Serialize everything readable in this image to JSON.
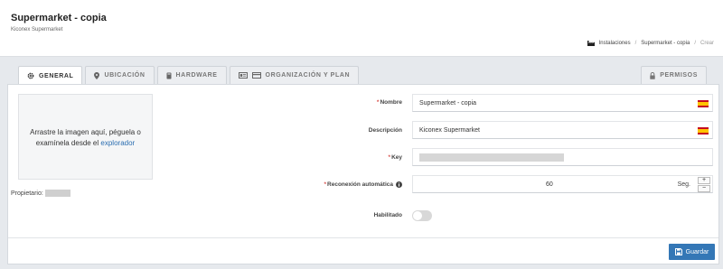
{
  "header": {
    "title": "Supermarket - copia",
    "subtitle": "Kiconex Supermarket",
    "breadcrumb": [
      "Instalaciones",
      "Supermarket - copia",
      "Crear"
    ]
  },
  "tabs": [
    {
      "label": "GENERAL",
      "icon": "gear-icon",
      "active": true
    },
    {
      "label": "UBICACIÓN",
      "icon": "map-marker-icon",
      "active": false
    },
    {
      "label": "HARDWARE",
      "icon": "hardware-icon",
      "active": false
    },
    {
      "label": "ORGANIZACIÓN Y PLAN",
      "icon": "id-card-icon",
      "active": false
    }
  ],
  "permissions_tab": {
    "label": "PERMISOS",
    "icon": "lock-icon"
  },
  "dropzone": {
    "text": "Arrastre la imagen aquí, péguela o examínela desde el",
    "link": "explorador"
  },
  "owner": {
    "label": "Propietario:"
  },
  "form": {
    "name": {
      "label": "Nombre",
      "required": true,
      "value": "Supermarket - copia",
      "flag": "es-flag-icon"
    },
    "description": {
      "label": "Descripción",
      "required": false,
      "value": "Kiconex Supermarket",
      "flag": "es-flag-icon"
    },
    "key": {
      "label": "Key",
      "required": true
    },
    "reconnect": {
      "label": "Reconexión automática",
      "required": true,
      "value": "60",
      "unit": "Seg.",
      "icon": "info-icon"
    },
    "enabled": {
      "label": "Habilitado",
      "checked": false
    }
  },
  "save_button": {
    "label": "Guardar",
    "icon": "save-icon"
  },
  "colors": {
    "accent": "#3477b6",
    "required": "#d9534f",
    "link": "#2a6db0"
  }
}
